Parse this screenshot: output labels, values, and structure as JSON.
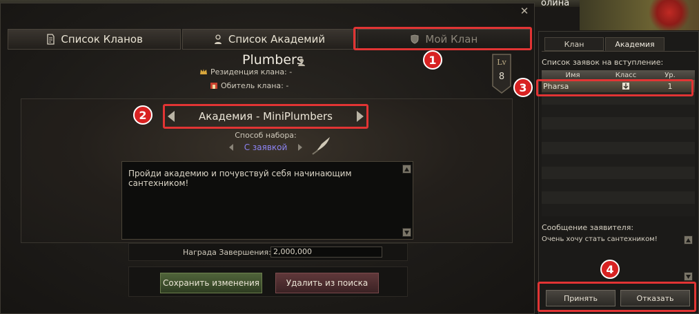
{
  "background": {
    "player_name": "олина"
  },
  "main_tabs": [
    {
      "label": "Список Кланов",
      "icon": "scroll-icon"
    },
    {
      "label": "Список Академий",
      "icon": "academy-icon"
    },
    {
      "label": "Мой Клан",
      "icon": "shield-icon",
      "active": true
    }
  ],
  "clan": {
    "name": "Plumbers",
    "residence": "Резиденция клана: -",
    "abode": "Обитель клана: -",
    "level_label": "Lv",
    "level": "8"
  },
  "academy": {
    "selector_label": "Академия - MiniPlumbers",
    "recruit_method_label": "Способ набора:",
    "recruit_method_value": "С заявкой",
    "description": "Пройди академию и почувствуй себя начинающим сантехником!",
    "reward_label": "Награда Завершения:",
    "reward_value": "2,000,000",
    "save_button": "Сохранить изменения",
    "remove_button": "Удалить из поиска"
  },
  "right_panel": {
    "tabs": [
      {
        "label": "Клан"
      },
      {
        "label": "Академия",
        "active": true
      }
    ],
    "applications_label": "Список заявок на вступление:",
    "columns": [
      "Имя",
      "Класс",
      "Ур."
    ],
    "applicants": [
      {
        "name": "Pharsa",
        "class_icon": "class-icon",
        "level": "1"
      }
    ],
    "message_label": "Сообщение заявителя:",
    "message_text": "Очень хочу стать сантехником!",
    "accept_button": "Принять",
    "reject_button": "Отказать"
  },
  "annotations": [
    "1",
    "2",
    "3",
    "4"
  ],
  "colors": {
    "highlight": "#e23434",
    "recruit_value": "#8c83f2",
    "accent_gold": "#bfae87"
  }
}
